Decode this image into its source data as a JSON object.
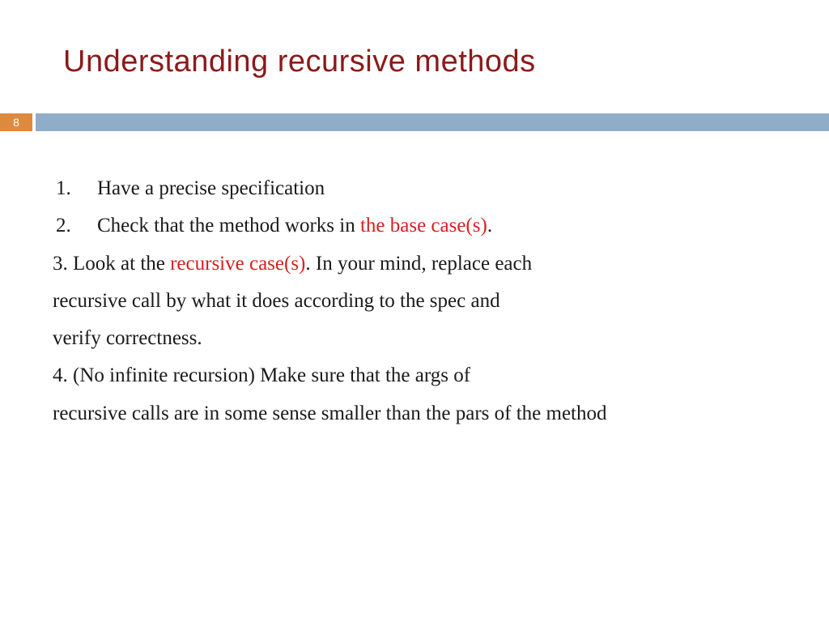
{
  "title": "Understanding recursive methods",
  "pageNumber": "8",
  "items": {
    "n1": "1.",
    "t1": "Have a precise specification",
    "n2": "2.",
    "t2a": "Check that the method works in ",
    "t2b": "the base case(s)",
    "t2c": ".",
    "t3a": "3. Look at the ",
    "t3b": "recursive case(s)",
    "t3c": ". In your mind, replace each",
    "t3d": "recursive call by what it does according to the spec and",
    "t3e": "verify correctness.",
    "t4a": "4. (No infinite recursion) Make sure that the args of",
    "t4b": "recursive calls are in some sense smaller than the pars of the method"
  }
}
